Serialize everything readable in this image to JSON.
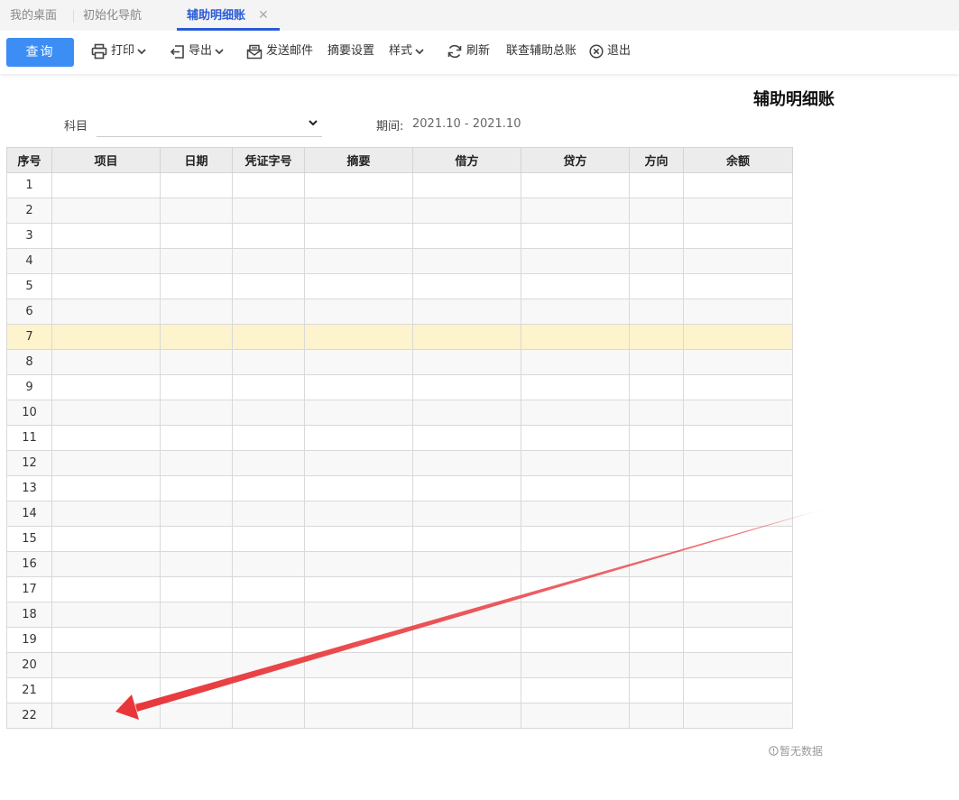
{
  "tabs": [
    {
      "label": "我的桌面"
    },
    {
      "label": "初始化导航"
    },
    {
      "label": "辅助明细账"
    }
  ],
  "toolbar": {
    "query": "查询",
    "print": "打印",
    "export": "导出",
    "email": "发送邮件",
    "summary_settings": "摘要设置",
    "style": "样式",
    "refresh": "刷新",
    "linked_ledger": "联查辅助总账",
    "exit": "退出"
  },
  "report": {
    "title": "辅助明细账",
    "subject_label": "科目",
    "subject_value": "",
    "period_label": "期间:",
    "period_value": "2021.10 - 2021.10"
  },
  "table": {
    "headers": [
      "序号",
      "项目",
      "日期",
      "凭证字号",
      "摘要",
      "借方",
      "贷方",
      "方向",
      "余额"
    ],
    "rows": [
      "1",
      "2",
      "3",
      "4",
      "5",
      "6",
      "7",
      "8",
      "9",
      "10",
      "11",
      "12",
      "13",
      "14",
      "15",
      "16",
      "17",
      "18",
      "19",
      "20",
      "21",
      "22"
    ],
    "highlighted_row": 7
  },
  "empty_text": "暂无数据",
  "colors": {
    "accent": "#2a5bd7",
    "query_button": "#3c8ef5",
    "highlight_row": "#fdf3cc",
    "annotation_arrow": "#e8363a"
  },
  "icons": {
    "print": "printer-icon",
    "export": "export-icon",
    "email": "mail-icon",
    "refresh": "refresh-icon",
    "exit": "close-circle-icon",
    "empty": "info-icon"
  }
}
